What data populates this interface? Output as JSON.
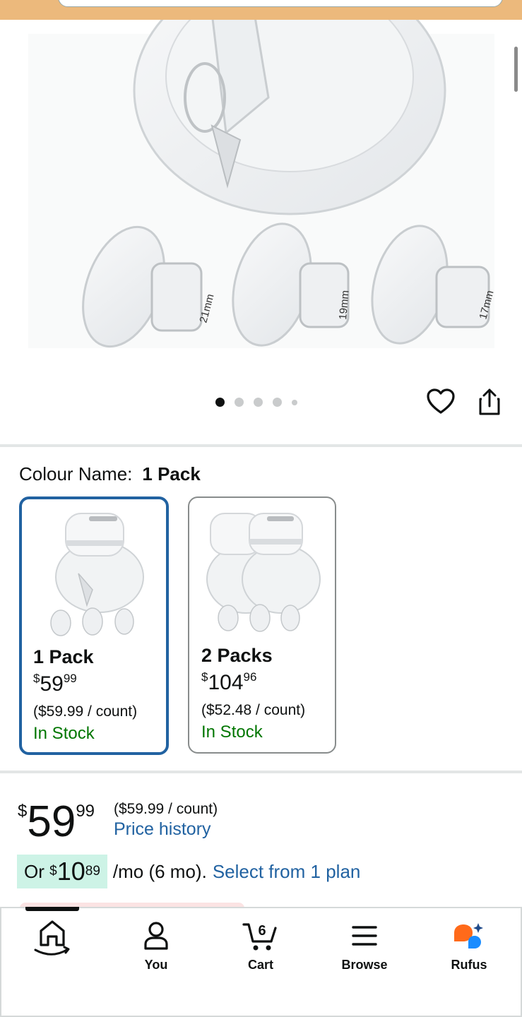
{
  "gallery": {
    "flange_labels": [
      "21mm",
      "19mm",
      "17mm"
    ],
    "dots_total": 5,
    "active_dot": 1
  },
  "variation": {
    "label": "Colour Name:",
    "selected": "1 Pack",
    "options": [
      {
        "title": "1 Pack",
        "price_whole": "59",
        "price_fraction": "99",
        "currency": "$",
        "per_unit": "($59.99 / count)",
        "stock": "In Stock",
        "selected": true
      },
      {
        "title": "2 Packs",
        "price_whole": "104",
        "price_fraction": "96",
        "currency": "$",
        "per_unit": "($52.48 / count)",
        "stock": "In Stock",
        "selected": false
      }
    ]
  },
  "price": {
    "currency": "$",
    "whole": "59",
    "fraction": "99",
    "per_unit": "($59.99 / count)",
    "history_link": "Price history"
  },
  "installment": {
    "prefix": "Or",
    "currency": "$",
    "whole": "10",
    "fraction": "89",
    "suffix": "/mo (6 mo).",
    "link": "Select from 1 plan"
  },
  "bottom_nav": {
    "items": [
      {
        "label": "",
        "icon": "home-icon"
      },
      {
        "label": "You",
        "icon": "user-icon"
      },
      {
        "label": "Cart",
        "icon": "cart-icon",
        "badge": "6"
      },
      {
        "label": "Browse",
        "icon": "menu-icon"
      },
      {
        "label": "Rufus",
        "icon": "rufus-icon"
      }
    ]
  },
  "colors": {
    "link": "#2162a1",
    "stock": "#007600",
    "selected_border": "#2162a1",
    "header": "#ecb97c",
    "installment_bg": "#cdf3e6",
    "rufus_orange": "#ff6a1a",
    "rufus_blue": "#1a8cff"
  }
}
